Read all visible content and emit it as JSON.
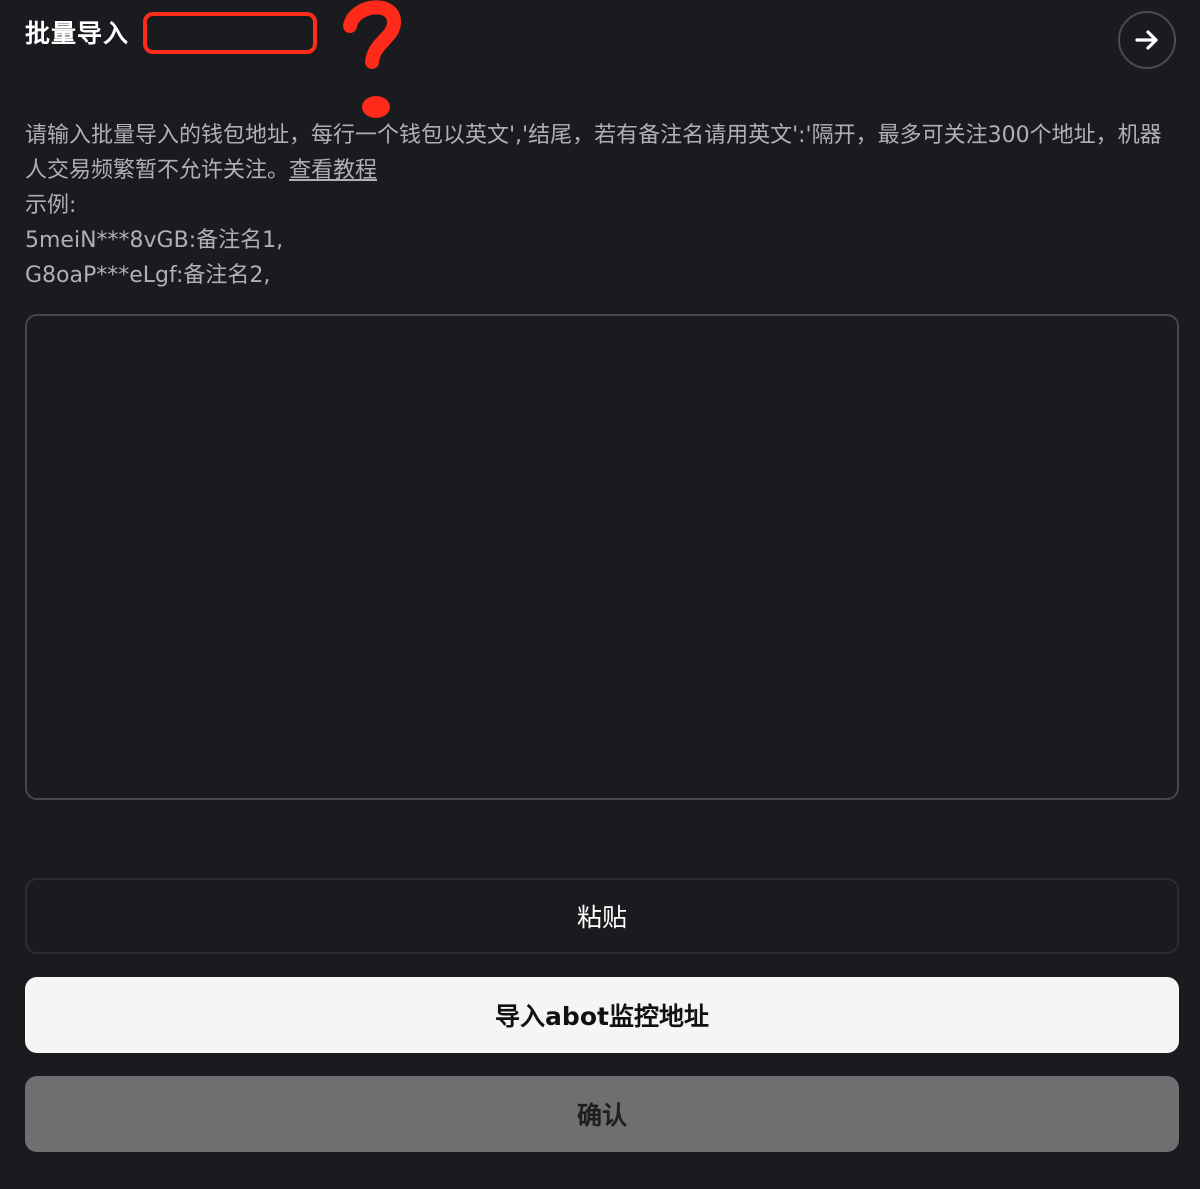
{
  "header": {
    "title": "批量导入"
  },
  "annotation": {
    "mark": "?",
    "color": "#ff2a1a"
  },
  "close_button": {
    "icon": "arrow-right-icon"
  },
  "description": {
    "text": "请输入批量导入的钱包地址，每行一个钱包以英文','结尾，若有备注名请用英文':'隔开，最多可关注300个地址，机器人交易频繁暂不允许关注。",
    "tutorial_link": "查看教程",
    "example_label": "示例:",
    "example_line_1": "5meiN***8vGB:备注名1,",
    "example_line_2": "G8oaP***eLgf:备注名2,"
  },
  "input": {
    "value": "",
    "placeholder": ""
  },
  "buttons": {
    "paste": "粘贴",
    "import_abot": "导入abot监控地址",
    "confirm": "确认"
  },
  "colors": {
    "background": "#1a1b1f",
    "primary_button": "#f5f5f5",
    "disabled_button": "#6f6f72",
    "annotation_red": "#ff2a1a"
  }
}
